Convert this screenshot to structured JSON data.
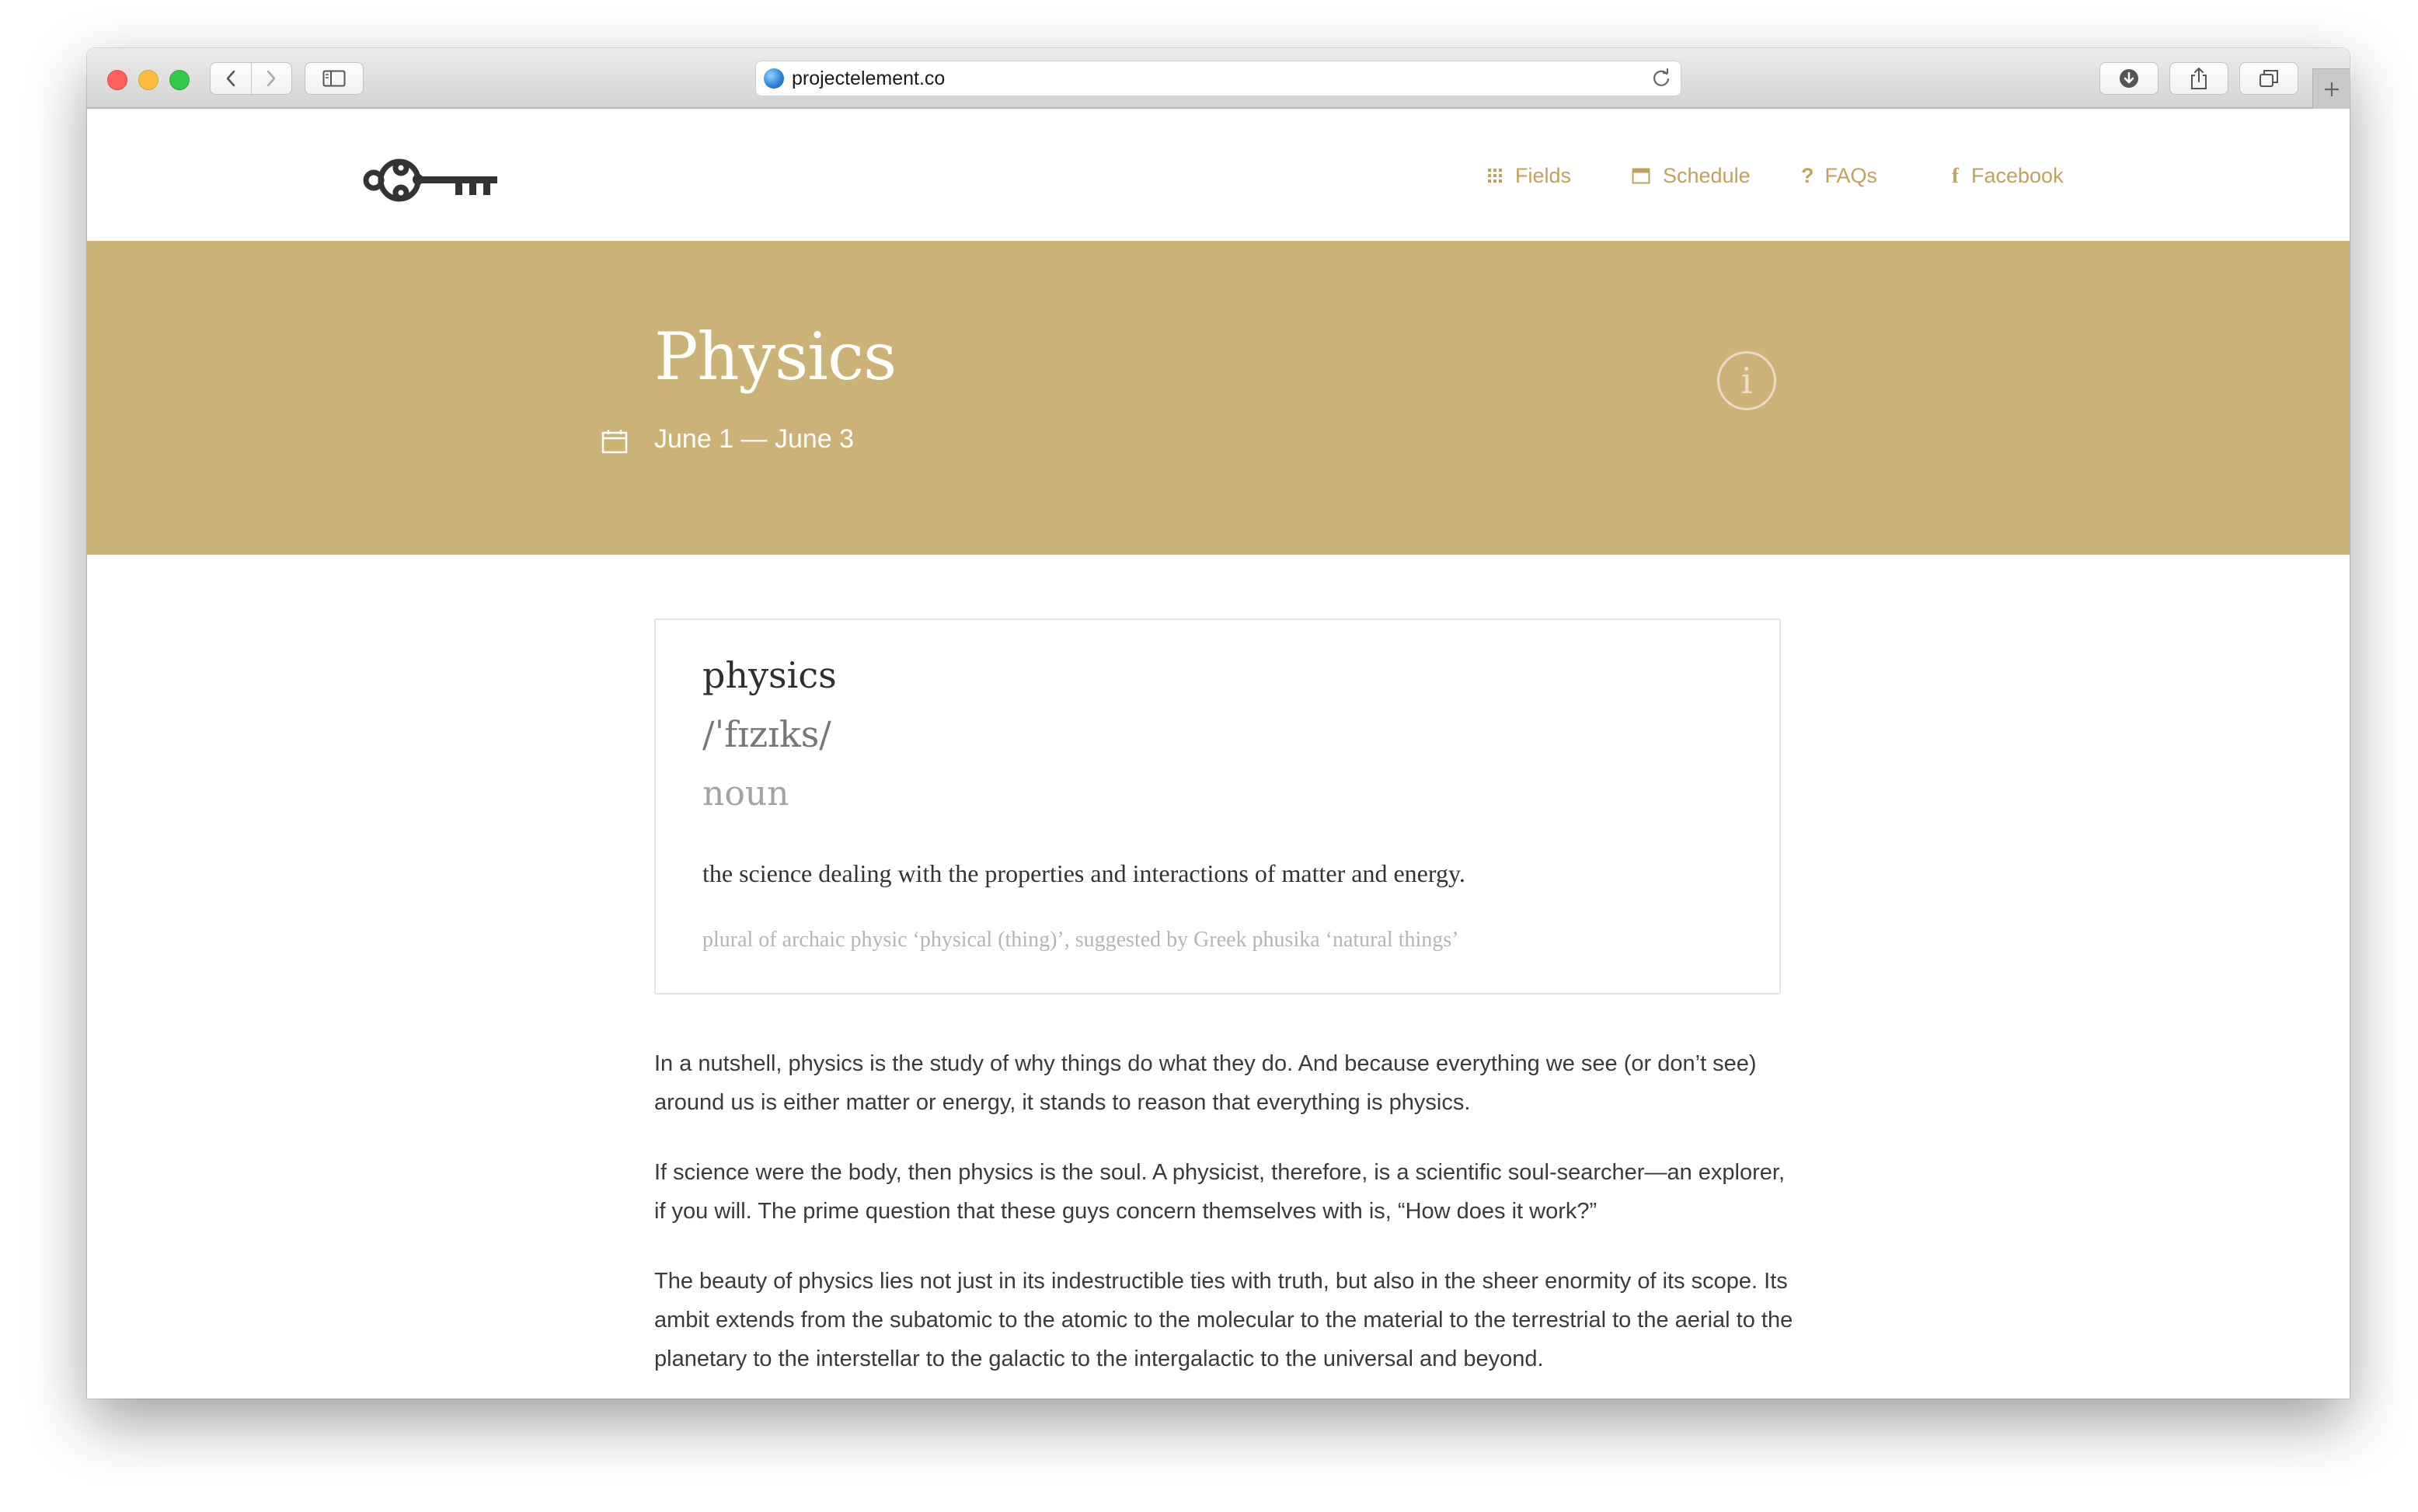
{
  "browser": {
    "url": "projectelement.co"
  },
  "nav": {
    "items": [
      {
        "label": "Fields",
        "icon": "grid-icon"
      },
      {
        "label": "Schedule",
        "icon": "calendar-icon"
      },
      {
        "label": "FAQs",
        "icon": "question-icon"
      },
      {
        "label": "Facebook",
        "icon": "facebook-icon"
      }
    ]
  },
  "hero": {
    "title": "Physics",
    "dates": "June 1 — June 3",
    "info_glyph": "i"
  },
  "definition": {
    "word": "physics",
    "ipa": "/ˈfɪzɪks/",
    "part_of_speech": "noun",
    "meaning": "the science dealing with the properties and interactions of matter and energy.",
    "etymology": "plural of archaic physic ‘physical (thing)’, suggested by Greek phusika ‘natural things’"
  },
  "body": {
    "paragraphs": [
      "In a nutshell, physics is the study of why things do what they do. And because everything we see (or don’t see) around us is either matter or energy, it stands to reason that everything is physics.",
      "If science were the body, then physics is the soul. A physicist, therefore, is a scientific soul-searcher—an explorer, if you will. The prime question that these guys concern themselves with is, “How does it work?”",
      "The beauty of physics lies not just in its indestructible ties with truth, but also in the sheer enormity of its scope. Its ambit extends from the subatomic to the atomic to the molecular to the material to the terrestrial to the aerial to the planetary to the interstellar to the galactic to the intergalactic to the universal and beyond."
    ]
  },
  "colors": {
    "accent": "#cbb276",
    "nav_text": "#c2a25a",
    "body_text": "#3a3a3a"
  }
}
